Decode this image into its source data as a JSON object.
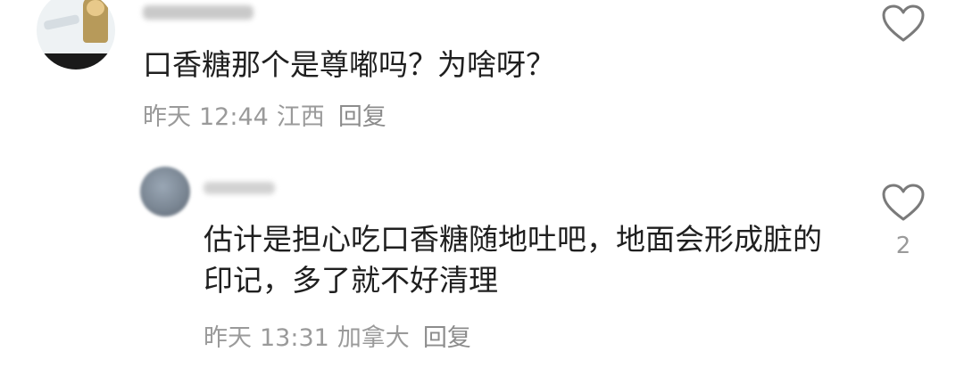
{
  "comments": [
    {
      "text": "口香糖那个是尊嘟吗？为啥呀？",
      "date": "昨天",
      "time": "12:44",
      "location": "江西",
      "reply_label": "回复",
      "avatar_icon": "user-avatar-icon",
      "like_icon": "heart-outline-icon"
    },
    {
      "text": "估计是担心吃口香糖随地吐吧，地面会形成脏的印记，多了就不好清理",
      "date": "昨天",
      "time": "13:31",
      "location": "加拿大",
      "reply_label": "回复",
      "like_count": "2",
      "avatar_icon": "user-avatar-icon",
      "like_icon": "heart-outline-icon"
    }
  ],
  "colors": {
    "text": "#1f1f1f",
    "meta": "#9a9a9a",
    "icon": "#7a7a7a"
  }
}
